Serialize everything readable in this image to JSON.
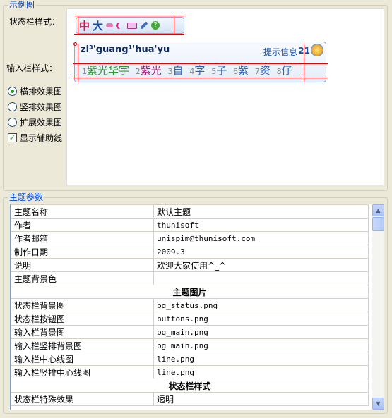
{
  "preview_group": {
    "legend": "示例图",
    "status_label": "状态栏样式：",
    "input_label": "输入栏样式：",
    "status_bar": {
      "zh": "中",
      "da": "大",
      "icons": [
        "dots-icon",
        "moon-icon",
        "keyboard-icon",
        "wrench-icon",
        "help-icon"
      ]
    },
    "input_bar": {
      "composition": "zi³'guang¹'hua'yu",
      "hint": "提示信息",
      "page": "21",
      "candidates": [
        {
          "num": "1",
          "text": "紫光华宇"
        },
        {
          "num": "2",
          "text": "紫光"
        },
        {
          "num": "3",
          "text": "自"
        },
        {
          "num": "4",
          "text": "字"
        },
        {
          "num": "5",
          "text": "子"
        },
        {
          "num": "6",
          "text": "紫"
        },
        {
          "num": "7",
          "text": "资"
        },
        {
          "num": "8",
          "text": "仔"
        }
      ]
    },
    "options": {
      "horizontal": "横排效果图",
      "vertical": "竖排效果图",
      "extended": "扩展效果图",
      "show_guides": "显示辅助线",
      "selected": "horizontal",
      "guides_checked": true
    }
  },
  "theme_group": {
    "legend": "主题参数",
    "rows": [
      {
        "key": "主题名称",
        "value": "默认主题"
      },
      {
        "key": "作者",
        "value": "thunisoft"
      },
      {
        "key": "作者邮箱",
        "value": "unispim@thunisoft.com"
      },
      {
        "key": "制作日期",
        "value": "2009.3"
      },
      {
        "key": "说明",
        "value": "欢迎大家使用^_^"
      },
      {
        "key": "主题背景色",
        "value": ""
      },
      {
        "section": "主题图片"
      },
      {
        "key": "状态栏背景图",
        "value": "bg_status.png"
      },
      {
        "key": "状态栏按钮图",
        "value": "buttons.png"
      },
      {
        "key": "输入栏背景图",
        "value": "bg_main.png"
      },
      {
        "key": "输入栏竖排背景图",
        "value": "bg_main.png"
      },
      {
        "key": "输入栏中心线图",
        "value": "line.png"
      },
      {
        "key": "输入栏竖排中心线图",
        "value": "line.png"
      },
      {
        "section": "状态栏样式"
      },
      {
        "key": "状态栏特殊效果",
        "value": "透明"
      }
    ]
  }
}
